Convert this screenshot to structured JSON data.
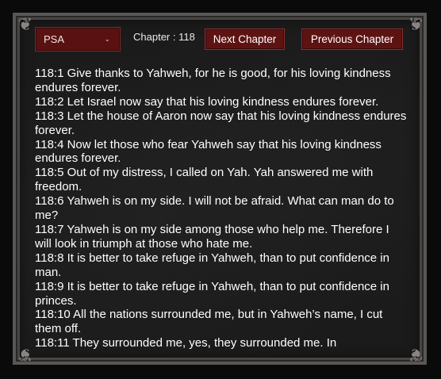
{
  "book_select": {
    "value": "PSA"
  },
  "chapter": {
    "label": "Chapter : 118"
  },
  "buttons": {
    "next": "Next Chapter",
    "previous": "Previous Chapter"
  },
  "verses": [
    "118:1 Give thanks to Yahweh, for he is good, for his loving kindness endures forever.",
    "118:2 Let Israel now say that his loving kindness endures forever.",
    "118:3 Let the house of Aaron now say that his loving kindness endures forever.",
    "118:4 Now let those who fear Yahweh say that his loving kindness endures forever.",
    "118:5 Out of my distress, I called on Yah. Yah answered me with freedom.",
    "118:6 Yahweh is on my side. I will not be afraid. What can man do to me?",
    "118:7 Yahweh is on my side among those who help me. Therefore I will look in triumph at those who hate me.",
    "118:8 It is better to take refuge in Yahweh, than to put confidence in man.",
    "118:9 It is better to take refuge in Yahweh, than to put confidence in princes.",
    "118:10 All the nations surrounded me, but in Yahweh’s name, I cut them off.",
    "118:11 They surrounded me, yes, they surrounded me. In"
  ]
}
